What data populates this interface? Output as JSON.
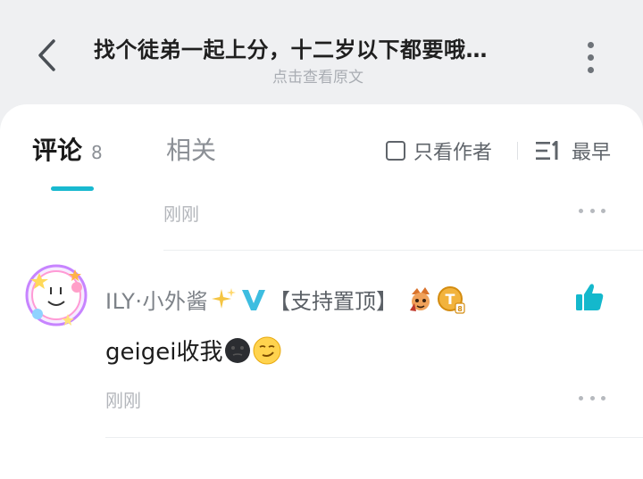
{
  "header": {
    "title": "找个徒弟一起上分，十二岁以下都要哦…",
    "subtitle": "点击查看原文"
  },
  "tabs": [
    {
      "label": "评论",
      "count": "8"
    },
    {
      "label": "相关"
    }
  ],
  "filters": {
    "author_only": "只看作者",
    "sort": "最早"
  },
  "comments": [
    {
      "time": "刚刚"
    },
    {
      "username": "ILY·小外酱",
      "badge": "【支持置顶】",
      "text": "geigei收我",
      "time": "刚刚"
    }
  ],
  "colors": {
    "accent": "#19b9d0",
    "verified": "#3dbde0",
    "like": "#14b8cc",
    "page_bg": "#eff0f2"
  },
  "icons": [
    "back-arrow-icon",
    "more-vertical-icon",
    "checkbox-icon",
    "sort-icon",
    "more-horizontal-icon",
    "verified-v-icon",
    "sparkle-icon",
    "character-badge-icon",
    "t-level-badge-icon",
    "thumbs-up-icon",
    "black-moon-emoji-icon",
    "smirk-emoji-icon"
  ]
}
